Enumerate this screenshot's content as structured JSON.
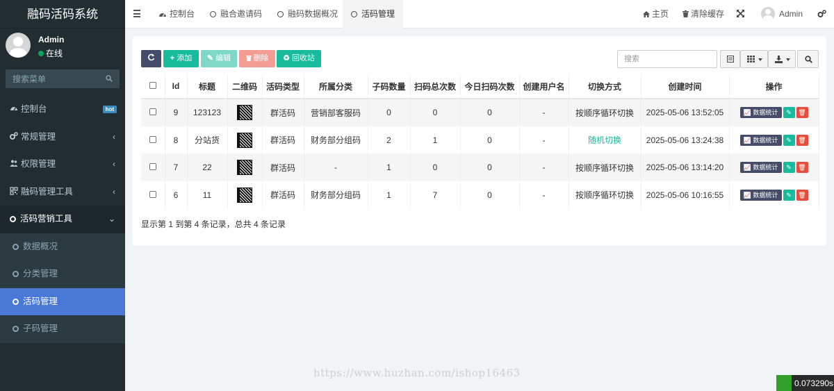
{
  "app": {
    "title": "融码活码系统"
  },
  "user": {
    "name": "Admin",
    "status": "在线"
  },
  "search_menu": {
    "placeholder": "搜索菜单"
  },
  "menu": {
    "items": [
      {
        "label": "控制台",
        "badge": "hot"
      },
      {
        "label": "常规管理"
      },
      {
        "label": "权限管理"
      },
      {
        "label": "融码管理工具"
      },
      {
        "label": "活码营销工具"
      }
    ],
    "sub_items": [
      {
        "label": "数据概况"
      },
      {
        "label": "分类管理"
      },
      {
        "label": "活码管理"
      },
      {
        "label": "子码管理"
      }
    ]
  },
  "tabs": [
    {
      "label": "控制台"
    },
    {
      "label": "融合邀请码"
    },
    {
      "label": "融码数据概况"
    },
    {
      "label": "活码管理"
    }
  ],
  "topright": {
    "home": "主页",
    "clear_cache": "清除缓存",
    "user": "Admin"
  },
  "toolbar": {
    "add": "添加",
    "edit": "编辑",
    "delete": "删除",
    "recycle": "回收站",
    "search_placeholder": "搜索"
  },
  "table": {
    "headers": [
      "Id",
      "标题",
      "二维码",
      "活码类型",
      "所属分类",
      "子码数量",
      "扫码总次数",
      "今日扫码次数",
      "创建用户名",
      "切换方式",
      "创建时间",
      "操作"
    ],
    "rows": [
      {
        "id": "9",
        "title": "123123",
        "type": "群活码",
        "category": "营销部客服码",
        "sub_count": "0",
        "total_scans": "0",
        "today_scans": "0",
        "creator": "-",
        "switch": "按顺序循环切换",
        "created": "2025-05-06 13:52:05"
      },
      {
        "id": "8",
        "title": "分站货",
        "type": "群活码",
        "category": "财务部分组码",
        "sub_count": "2",
        "total_scans": "1",
        "today_scans": "0",
        "creator": "-",
        "switch": "随机切换",
        "created": "2025-05-06 13:24:38"
      },
      {
        "id": "7",
        "title": "22",
        "type": "群活码",
        "category": "-",
        "sub_count": "1",
        "total_scans": "0",
        "today_scans": "0",
        "creator": "-",
        "switch": "按顺序循环切换",
        "created": "2025-05-06 13:14:20"
      },
      {
        "id": "6",
        "title": "11",
        "type": "群活码",
        "category": "财务部分组码",
        "sub_count": "1",
        "total_scans": "7",
        "today_scans": "0",
        "creator": "-",
        "switch": "按顺序循环切换",
        "created": "2025-05-06 10:16:55"
      }
    ],
    "action_stats": "数据统计"
  },
  "pagination": {
    "info": "显示第 1 到第 4 条记录，总共 4 条记录"
  },
  "watermark": "https://www.huzhan.com/ishop16463",
  "timer": "0.073290s",
  "colors": {
    "accent": "#18bc9c",
    "sidebar": "#222d32",
    "active_menu": "#4a78d6",
    "danger": "#e74c3c",
    "dark_button": "#444c69"
  }
}
